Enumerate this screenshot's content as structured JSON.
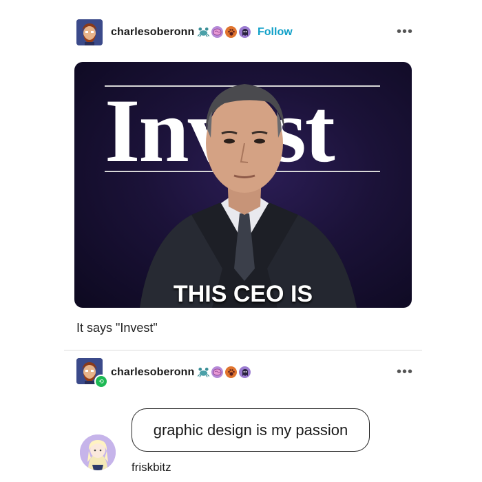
{
  "post": {
    "author": {
      "username": "charlesoberonn",
      "badges": [
        "crab-badge-icon",
        "brain-badge-icon",
        "paw-badge-icon",
        "ghost-badge-icon"
      ],
      "follow_label": "Follow"
    },
    "more_label": "•••",
    "image": {
      "title": "Invest",
      "caption": "THIS CEO IS"
    },
    "text": "It says \"Invest\""
  },
  "reblog": {
    "author": {
      "username": "charlesoberonn",
      "badges": [
        "crab-badge-icon",
        "brain-badge-icon",
        "paw-badge-icon",
        "ghost-badge-icon"
      ]
    },
    "more_label": "•••",
    "comment": {
      "text": "graphic design is my passion",
      "username": "friskbitz"
    }
  },
  "colors": {
    "follow": "#0fa0c8",
    "image_bg": "#1b1238",
    "reblog_badge": "#1db954"
  }
}
